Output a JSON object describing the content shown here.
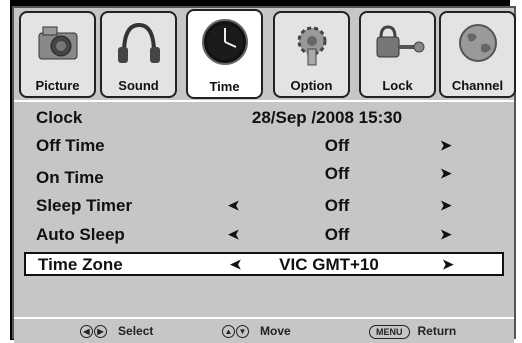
{
  "tabs": [
    {
      "label": "Picture",
      "icon": "camera-icon",
      "active": false
    },
    {
      "label": "Sound",
      "icon": "headphones-icon",
      "active": false
    },
    {
      "label": "Time",
      "icon": "clock-icon",
      "active": true
    },
    {
      "label": "Option",
      "icon": "gear-icon",
      "active": false
    },
    {
      "label": "Lock",
      "icon": "key-lock-icon",
      "active": false
    },
    {
      "label": "Channel",
      "icon": "globe-icon",
      "active": false
    }
  ],
  "menu": {
    "clock": {
      "label": "Clock",
      "value": "28/Sep  /2008 15:30"
    },
    "off_time": {
      "label": "Off Time",
      "value": "Off"
    },
    "on_time": {
      "label": "On Time",
      "value": "Off"
    },
    "sleep_timer": {
      "label": "Sleep Timer",
      "value": "Off"
    },
    "auto_sleep": {
      "label": "Auto Sleep",
      "value": "Off"
    },
    "time_zone": {
      "label": "Time Zone",
      "value": "VIC GMT+10",
      "selected": true
    }
  },
  "footer": {
    "select": {
      "icon": "left-right-arrows-icon",
      "label": "Select"
    },
    "move": {
      "icon": "up-down-arrows-icon",
      "label": "Move"
    },
    "return": {
      "key": "MENU",
      "label": "Return"
    }
  },
  "colors": {
    "panel": "#c6c6c6",
    "frame": "#000000",
    "highlight": "#ffffff"
  }
}
